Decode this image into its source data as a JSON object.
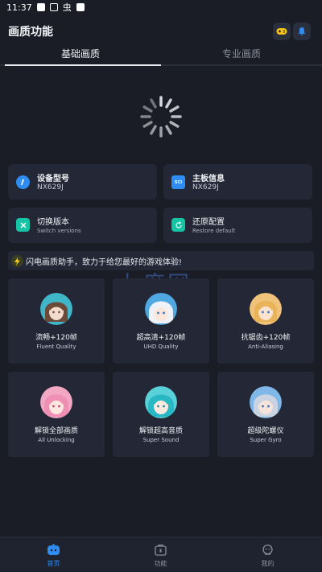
{
  "status_bar": {
    "time": "11:37",
    "debug_glyph": "虫"
  },
  "header": {
    "title": "画质功能",
    "game_icon": "gamepad-icon",
    "notify_icon": "bell-icon"
  },
  "tabs": [
    {
      "label": "基础画质",
      "active": true
    },
    {
      "label": "专业画质",
      "active": false
    }
  ],
  "loading": {
    "icon": "loading-spinner-icon"
  },
  "device": {
    "label": "设备型号",
    "value": "NX629J",
    "icon": "info-icon"
  },
  "board": {
    "label": "主板信息",
    "value": "NX629J",
    "icon": "chip-icon",
    "icon_text": "SCI"
  },
  "actions": [
    {
      "title": "切换版本",
      "subtitle": "Switch versions",
      "icon": "switch-icon"
    },
    {
      "title": "还原配置",
      "subtitle": "Restore default",
      "icon": "restore-icon"
    }
  ],
  "announcement": {
    "text": "闪电画质助手，致力于给您最好的游戏体验!",
    "icon": "lightning-icon"
  },
  "watermark": {
    "text": "七度网",
    "url": "www.7dn.net"
  },
  "features": [
    {
      "name": "流畅+120帧",
      "subtitle": "Fluent Quality",
      "avatar": "avatar-brown-hair"
    },
    {
      "name": "超高清+120帧",
      "subtitle": "UHD Quality",
      "avatar": "avatar-white-hair"
    },
    {
      "name": "抗锯齿+120帧",
      "subtitle": "Anti-Aliasing",
      "avatar": "avatar-blonde-hair"
    },
    {
      "name": "解锁全部画质",
      "subtitle": "All Unlocking",
      "avatar": "avatar-pink-hair"
    },
    {
      "name": "解锁超高音质",
      "subtitle": "Super Sound",
      "avatar": "avatar-teal-hair"
    },
    {
      "name": "超级陀螺仪",
      "subtitle": "Super Gyro",
      "avatar": "avatar-silver-hair"
    }
  ],
  "nav": [
    {
      "label": "首页",
      "icon": "home-icon",
      "active": true
    },
    {
      "label": "功能",
      "icon": "toolbox-icon",
      "active": false
    },
    {
      "label": "我的",
      "icon": "profile-icon",
      "active": false
    }
  ],
  "colors": {
    "background": "#1a1d26",
    "card": "#242836",
    "accent_blue": "#2f8cf0",
    "accent_teal": "#14c4a4",
    "accent_yellow": "#f4c419"
  }
}
